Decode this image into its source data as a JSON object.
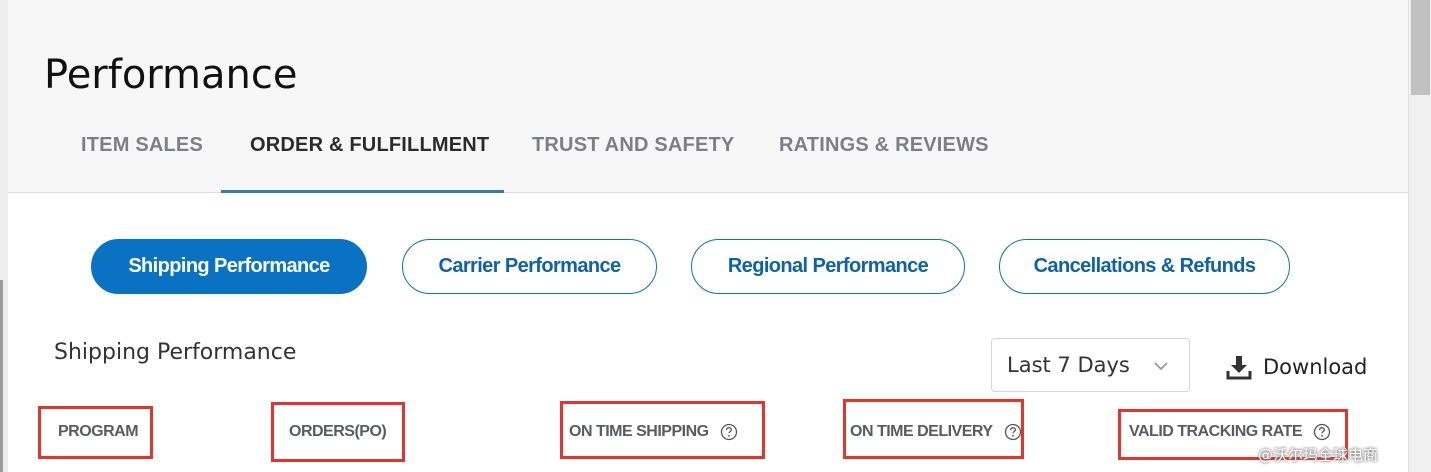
{
  "page": {
    "title": "Performance"
  },
  "tabs": [
    {
      "label": "ITEM SALES",
      "active": false
    },
    {
      "label": "ORDER & FULFILLMENT",
      "active": true
    },
    {
      "label": "TRUST AND SAFETY",
      "active": false
    },
    {
      "label": "RATINGS & REVIEWS",
      "active": false
    }
  ],
  "subtabs": [
    {
      "label": "Shipping Performance",
      "active": true
    },
    {
      "label": "Carrier Performance",
      "active": false
    },
    {
      "label": "Regional Performance",
      "active": false
    },
    {
      "label": "Cancellations & Refunds",
      "active": false
    }
  ],
  "section": {
    "title": "Shipping Performance"
  },
  "date_range": {
    "selected": "Last 7 Days",
    "icon": "chevron-down-icon"
  },
  "download": {
    "label": "Download",
    "icon": "download-icon"
  },
  "table": {
    "columns": [
      {
        "label": "PROGRAM",
        "help": false
      },
      {
        "label": "ORDERS(PO)",
        "help": false
      },
      {
        "label": "ON TIME SHIPPING",
        "help": true
      },
      {
        "label": "ON TIME DELIVERY",
        "help": true
      },
      {
        "label": "VALID TRACKING RATE",
        "help": true
      }
    ]
  },
  "watermark": "@沃尔玛全球电商",
  "colors": {
    "accent": "#0a72c2",
    "highlight": "#e8322c",
    "tab_active_underline": "#2a7fc1"
  }
}
